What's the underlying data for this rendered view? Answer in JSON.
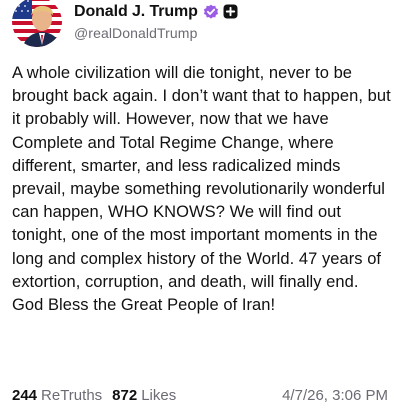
{
  "author": {
    "display_name": "Donald J. Trump",
    "handle": "@realDonaldTrump",
    "avatar_icon": "avatar-portrait-flag-icon",
    "verified_icon": "verified-check-icon",
    "badge_icon": "plus-badge-icon",
    "verified_color": "#9b5de5"
  },
  "post": {
    "text": "A whole civilization will die tonight, never to be brought back again. I don’t want that to happen, but it probably will. However, now that we have Complete and Total Regime Change, where different, smarter, and less radicalized minds prevail, maybe something revolutionarily wonderful can happen, WHO KNOWS? We will find out tonight, one of the most important moments in the long and complex history of the World. 47 years of extortion, corruption, and death, will finally end. God Bless the Great People of Iran!"
  },
  "stats": {
    "retruths_count": "244",
    "retruths_label": "ReTruths",
    "likes_count": "872",
    "likes_label": "Likes",
    "timestamp": "4/7/26, 3:06 PM"
  }
}
